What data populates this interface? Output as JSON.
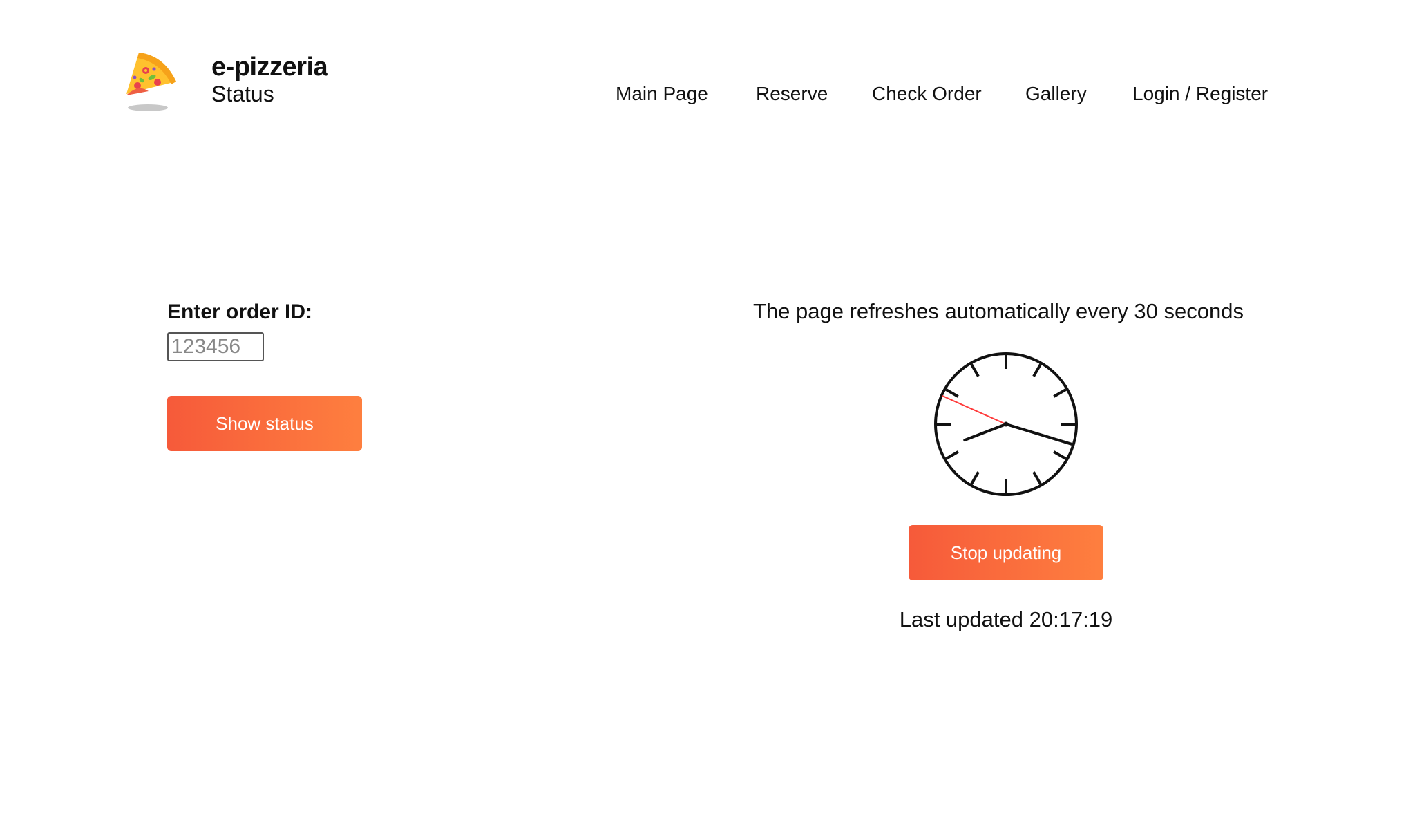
{
  "brand": {
    "name": "e-pizzeria",
    "page": "Status",
    "logo_icon": "pizza-slice-icon"
  },
  "nav": {
    "items": [
      {
        "label": "Main Page"
      },
      {
        "label": "Reserve"
      },
      {
        "label": "Check Order"
      },
      {
        "label": "Gallery"
      },
      {
        "label": "Login / Register"
      }
    ]
  },
  "order": {
    "label": "Enter order ID:",
    "input_value": "",
    "input_placeholder": "123456",
    "show_button": "Show status"
  },
  "refresh": {
    "note": "The page refreshes automatically every 30 seconds",
    "clock_icon": "clock-icon",
    "clock_time": {
      "hours": 20,
      "minutes": 17,
      "seconds": 49
    },
    "stop_button": "Stop updating",
    "last_updated_label": "Last updated",
    "last_updated_time": "20:17:19"
  },
  "colors": {
    "button_gradient_start": "#f65a3a",
    "button_gradient_end": "#fe7f3f",
    "second_hand": "#ff3b3b"
  }
}
